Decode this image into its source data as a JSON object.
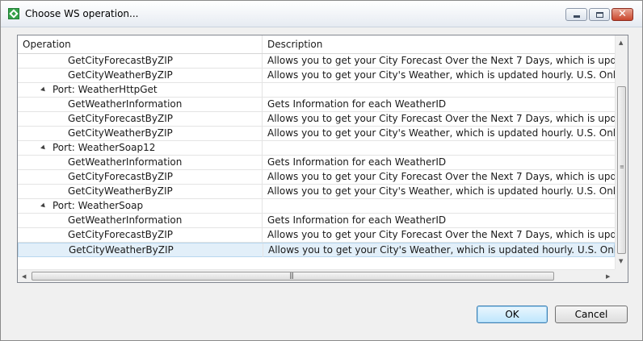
{
  "window": {
    "title": "Choose WS operation..."
  },
  "table": {
    "columns": {
      "operation": "Operation",
      "description": "Description"
    },
    "rows": [
      {
        "kind": "op",
        "operation": "GetCityForecastByZIP",
        "description": "Allows you to get your City Forecast Over the Next 7 Days, which is updated hourl",
        "selected": false
      },
      {
        "kind": "op",
        "operation": "GetCityWeatherByZIP",
        "description": "Allows you to get your City's Weather, which is updated hourly. U.S. Only",
        "selected": false
      },
      {
        "kind": "port",
        "operation": "Port: WeatherHttpGet",
        "description": "",
        "selected": false
      },
      {
        "kind": "op",
        "operation": "GetWeatherInformation",
        "description": "Gets Information for each WeatherID",
        "selected": false
      },
      {
        "kind": "op",
        "operation": "GetCityForecastByZIP",
        "description": "Allows you to get your City Forecast Over the Next 7 Days, which is updated hourl",
        "selected": false
      },
      {
        "kind": "op",
        "operation": "GetCityWeatherByZIP",
        "description": "Allows you to get your City's Weather, which is updated hourly. U.S. Only",
        "selected": false
      },
      {
        "kind": "port",
        "operation": "Port: WeatherSoap12",
        "description": "",
        "selected": false
      },
      {
        "kind": "op",
        "operation": "GetWeatherInformation",
        "description": "Gets Information for each WeatherID",
        "selected": false
      },
      {
        "kind": "op",
        "operation": "GetCityForecastByZIP",
        "description": "Allows you to get your City Forecast Over the Next 7 Days, which is updated hourl",
        "selected": false
      },
      {
        "kind": "op",
        "operation": "GetCityWeatherByZIP",
        "description": "Allows you to get your City's Weather, which is updated hourly. U.S. Only",
        "selected": false
      },
      {
        "kind": "port",
        "operation": "Port: WeatherSoap",
        "description": "",
        "selected": false
      },
      {
        "kind": "op",
        "operation": "GetWeatherInformation",
        "description": "Gets Information for each WeatherID",
        "selected": false
      },
      {
        "kind": "op",
        "operation": "GetCityForecastByZIP",
        "description": "Allows you to get your City Forecast Over the Next 7 Days, which is updated hourl",
        "selected": false
      },
      {
        "kind": "op",
        "operation": "GetCityWeatherByZIP",
        "description": "Allows you to get your City's Weather, which is updated hourly. U.S. Only",
        "selected": true
      }
    ]
  },
  "buttons": {
    "ok": "OK",
    "cancel": "Cancel"
  },
  "icons": {
    "app": "app-icon",
    "expanded": "expanded-triangle-icon"
  },
  "colors": {
    "selection": "#e2eff9",
    "ok_border": "#3c7fb1"
  }
}
